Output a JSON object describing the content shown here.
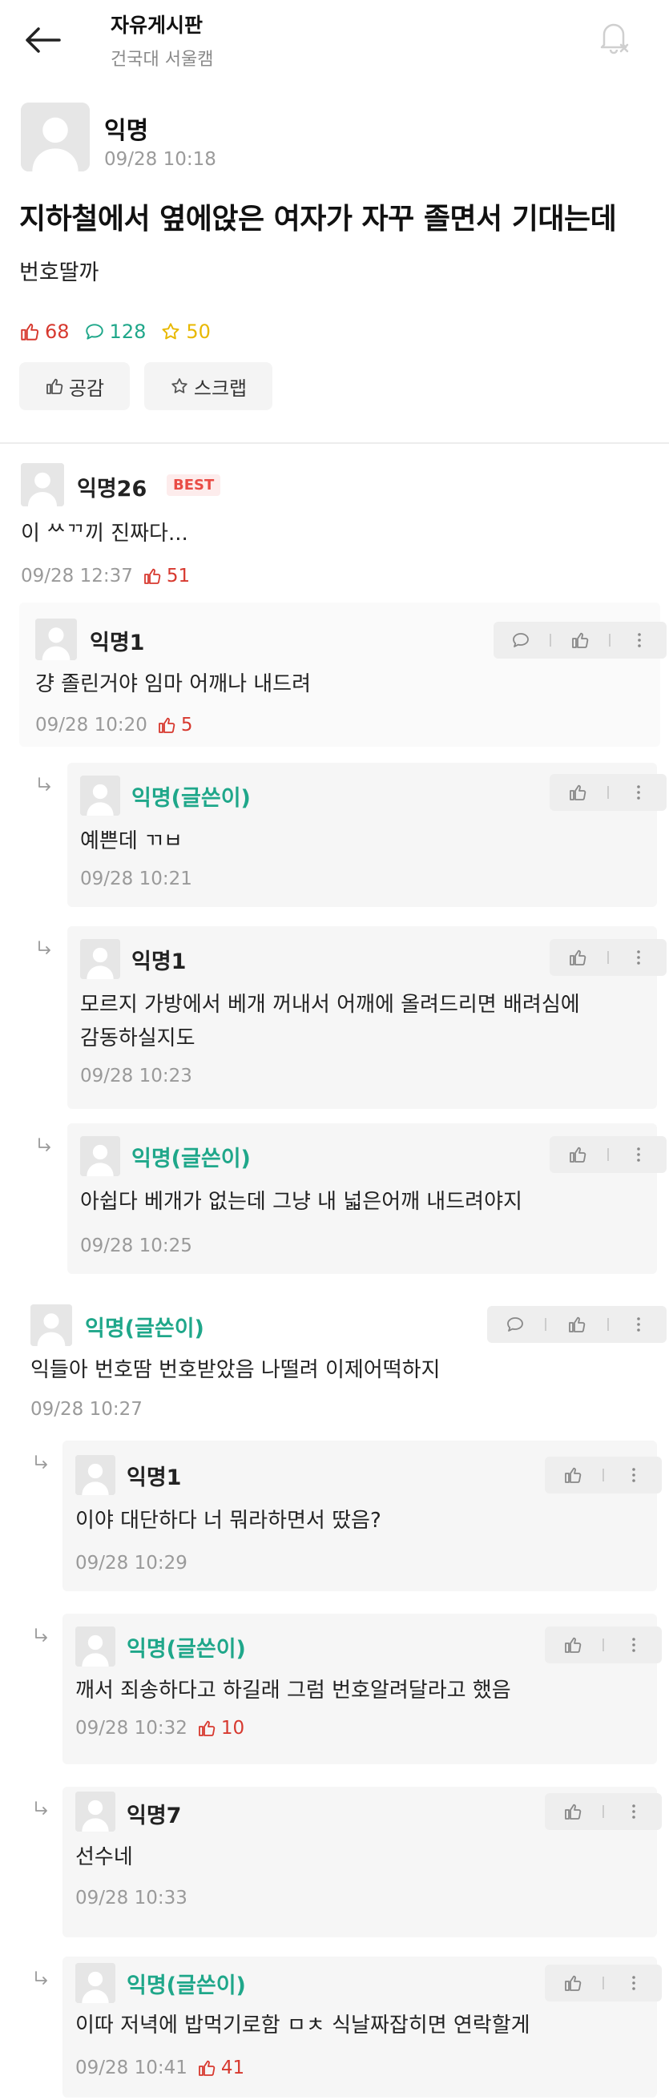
{
  "header": {
    "board_title": "자유게시판",
    "school": "건국대 서울캠"
  },
  "post": {
    "author": "익명",
    "time": "09/28 10:18",
    "title": "지하철에서 옆에앉은 여자가 자꾸 졸면서 기대는데",
    "body": "번호딸까",
    "likes": "68",
    "comments": "128",
    "scraps": "50",
    "like_button": "공감",
    "scrap_button": "스크랩"
  },
  "comments": [
    {
      "author": "익명26",
      "badge": "BEST",
      "text": "이 ᄊᄁ끼 진짜다...",
      "time": "09/28 12:37",
      "likes": "51"
    },
    {
      "author": "익명1",
      "text": "걍 졸린거야 임마 어깨나 내드려",
      "time": "09/28 10:20",
      "likes": "5"
    },
    {
      "author": "익명(글쓴이)",
      "text": "예쁜데 ㄲㅂ",
      "time": "09/28 10:21"
    },
    {
      "author": "익명1",
      "text": "모르지 가방에서 베개 꺼내서 어깨에 올려드리면 배려심에",
      "text2": "감동하실지도",
      "time": "09/28 10:23"
    },
    {
      "author": "익명(글쓴이)",
      "text": "아쉽다 베개가 없는데 그냥 내 넓은어깨 내드려야지",
      "time": "09/28 10:25"
    },
    {
      "author": "익명(글쓴이)",
      "text": "익들아 번호땀 번호받았음 나떨려 이제어떡하지",
      "time": "09/28 10:27"
    },
    {
      "author": "익명1",
      "text": "이야 대단하다 너 뭐라하면서 땄음?",
      "time": "09/28 10:29"
    },
    {
      "author": "익명(글쓴이)",
      "text": "깨서 죄송하다고 하길래 그럼 번호알려달라고 했음",
      "time": "09/28 10:32",
      "likes": "10"
    },
    {
      "author": "익명7",
      "text": "선수네",
      "time": "09/28 10:33"
    },
    {
      "author": "익명(글쓴이)",
      "text": "이따 저녁에 밥먹기로함 ㅁㅊ 식날짜잡히면 연락할게",
      "time": "09/28 10:41",
      "likes": "41"
    }
  ],
  "colors": {
    "op_author": "#1fa78a",
    "like_red": "#d7392f",
    "comment_teal": "#1fa78a",
    "scrap_yellow": "#e8b800"
  },
  "icons": [
    "back-arrow-icon",
    "bell-off-icon",
    "thumb-up-icon",
    "speech-bubble-icon",
    "star-icon",
    "more-vertical-icon",
    "reply-arrow-icon",
    "avatar-icon"
  ]
}
